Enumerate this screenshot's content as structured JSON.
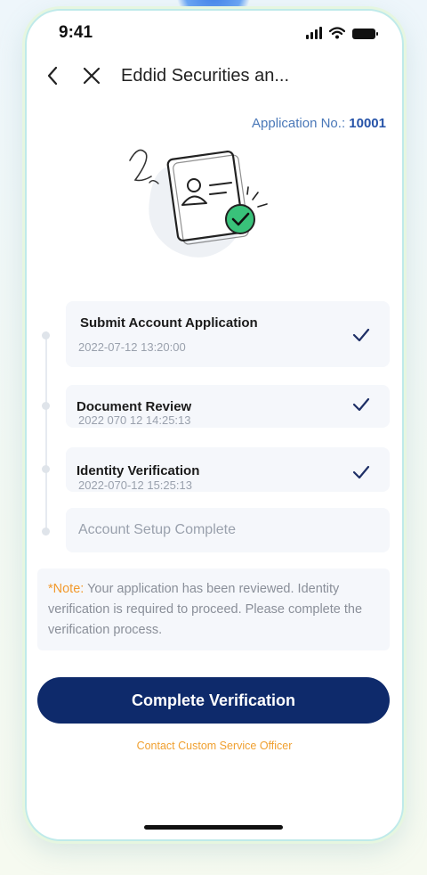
{
  "status_bar": {
    "time": "9:41"
  },
  "nav": {
    "title": "Eddid Securities an..."
  },
  "application": {
    "label": "Application No.:",
    "number": "10001"
  },
  "steps": [
    {
      "title": "Submit Account Application",
      "time": "2022-07-12 13:20:00",
      "done": true
    },
    {
      "title": "Document Review",
      "time": "2022 070 12 14:25:13",
      "done": true
    },
    {
      "title": "Identity Verification",
      "time": "2022-070-12 15:25:13",
      "done": true
    },
    {
      "title": "Account Setup Complete",
      "time": "",
      "done": false
    }
  ],
  "note": {
    "label": "*Note:",
    "text": "Your application has been reviewed. Identity verification is required to proceed. Please complete the verification process."
  },
  "actions": {
    "primary_label": "Complete Verification",
    "contact_label": "Contact Custom Service Officer"
  },
  "colors": {
    "primary": "#0e2a6b",
    "accent_orange": "#f29a2e",
    "link_blue": "#2653a8",
    "success_green": "#39c27a"
  }
}
